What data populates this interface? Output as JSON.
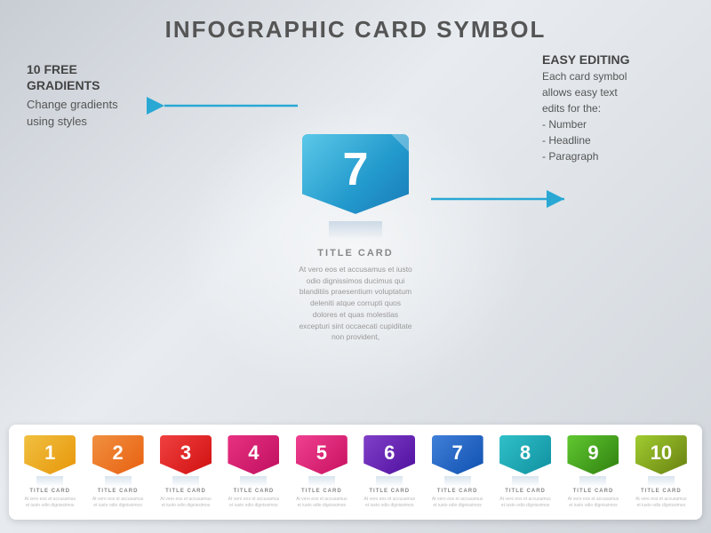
{
  "page": {
    "title": "INFOGRAPHIC CARD SYMBOL",
    "background": "#d0d5db"
  },
  "left_annotation": {
    "heading": "10 FREE\nGRADIENTS",
    "body": "Change gradients\nusing styles"
  },
  "right_annotation": {
    "heading": "EASY EDITING",
    "body": "Each card symbol\nallows easy text\nedits for the:\n- Number\n- Headline\n- Paragraph"
  },
  "center_card": {
    "number": "7",
    "title_label": "TITLE CARD",
    "paragraph": "At vero eos et accusamus et iusto odio dignissimos ducimus qui blanditiis praesentium voluptatum deleniti atque corrupti quos dolores et quas molestias excepturi sint occaecati cupiditate non provident,"
  },
  "strip_cards": [
    {
      "number": "1",
      "color_class": "c1",
      "title": "TITLE CARD",
      "para": "At vero eos et accusamus et iusto odio dignissimos"
    },
    {
      "number": "2",
      "color_class": "c2",
      "title": "TITLE CARD",
      "para": "At vero eos et accusamus et iusto odio dignissimos"
    },
    {
      "number": "3",
      "color_class": "c3",
      "title": "TITLE CARD",
      "para": "At vero eos et accusamus et iusto odio dignissimos"
    },
    {
      "number": "4",
      "color_class": "c4",
      "title": "TITLE CARD",
      "para": "At vero eos et accusamus et iusto odio dignissimos"
    },
    {
      "number": "5",
      "color_class": "c5",
      "title": "TITLE CARD",
      "para": "At vero eos et accusamus et iusto odio dignissimos"
    },
    {
      "number": "6",
      "color_class": "c6",
      "title": "TITLE CARD",
      "para": "At vero eos et accusamus et iusto odio dignissimos"
    },
    {
      "number": "7",
      "color_class": "c7",
      "title": "TITLE CARD",
      "para": "At vero eos et accusamus et iusto odio dignissimos"
    },
    {
      "number": "8",
      "color_class": "c8",
      "title": "TITLE CARD",
      "para": "At vero eos et accusamus et iusto odio dignissimos"
    },
    {
      "number": "9",
      "color_class": "c9",
      "title": "TITLE CARD",
      "para": "At vero eos et accusamus et iusto odio dignissimos"
    },
    {
      "number": "10",
      "color_class": "c10",
      "title": "TITLE CARD",
      "para": "At vero eos et accusamus et iusto odio dignissimos"
    }
  ]
}
